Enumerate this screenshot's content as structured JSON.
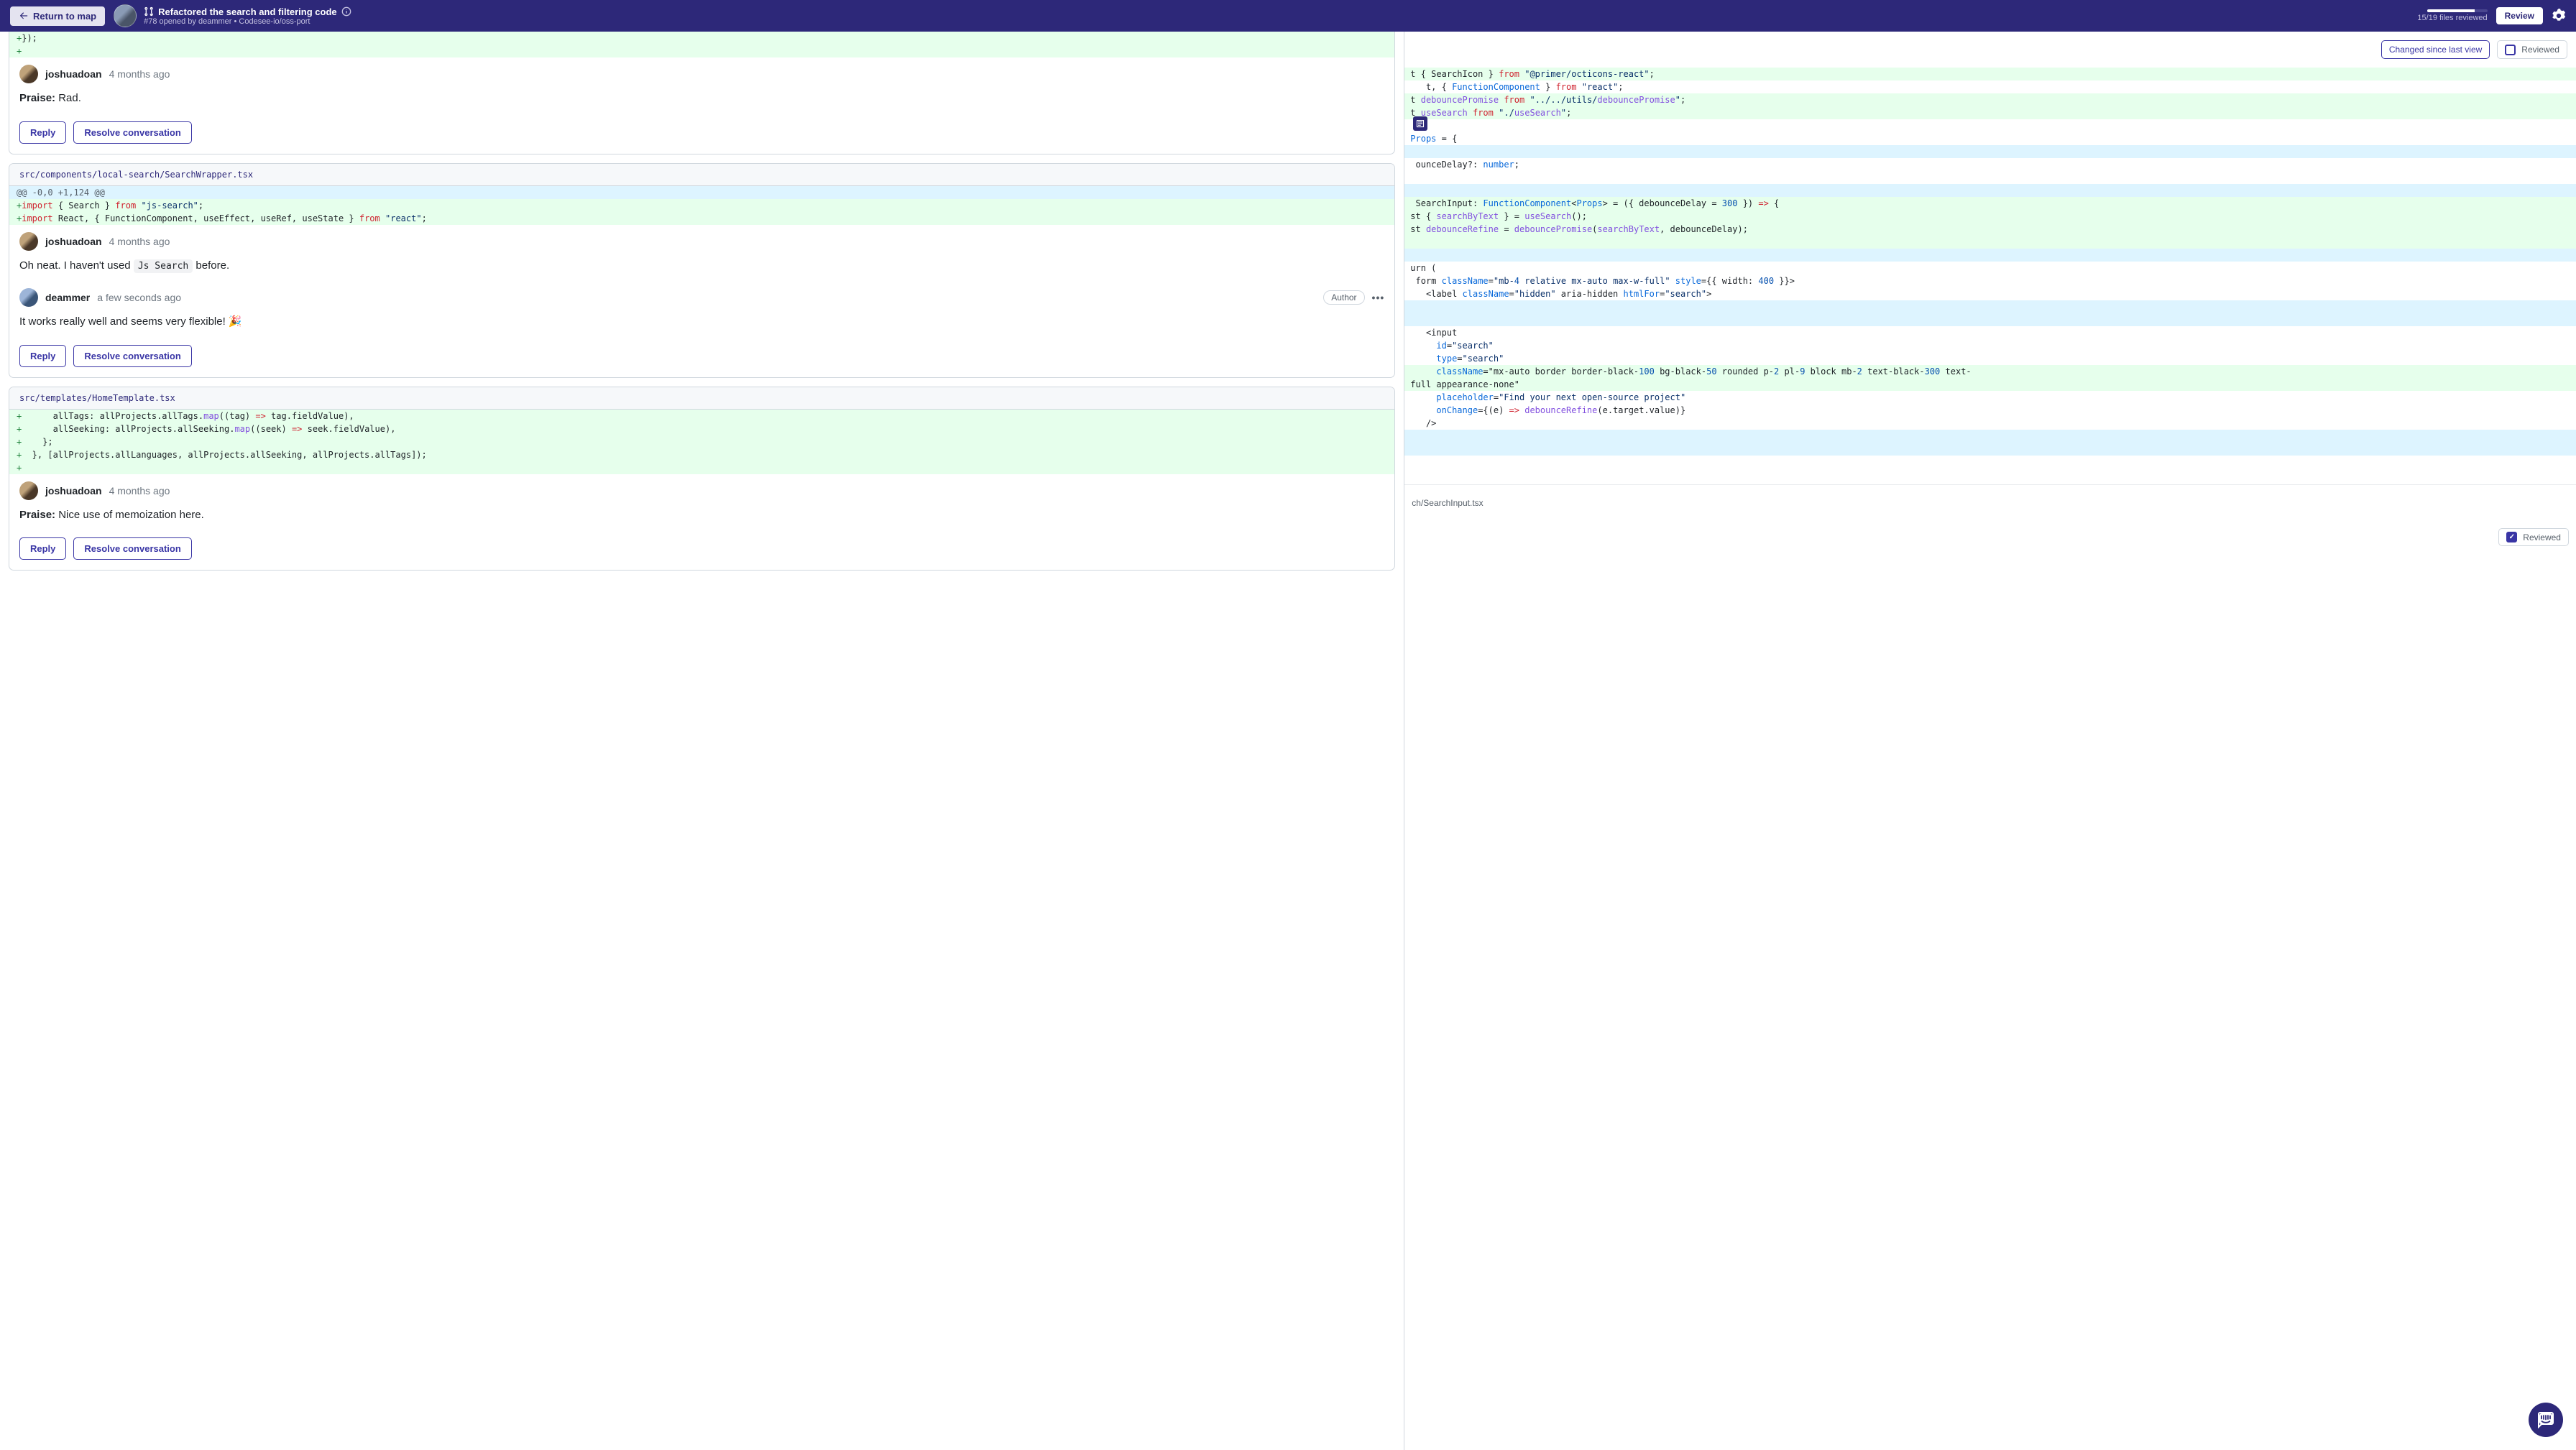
{
  "header": {
    "return_label": "Return to map",
    "pr_title": "Refactored the search and filtering code",
    "pr_meta": "#78 opened by deammer • Codesee-io/oss-port",
    "files_reviewed": "15/19 files reviewed",
    "review_btn": "Review"
  },
  "threads": [
    {
      "file": "",
      "diff_pre": "+});\n+",
      "comments": [
        {
          "author": "joshuadoan",
          "time": "4 months ago",
          "body_prefix": "Praise:",
          "body_rest": " Rad."
        }
      ],
      "reply": "Reply",
      "resolve": "Resolve conversation"
    },
    {
      "file": "src/components/local-search/SearchWrapper.tsx",
      "hunk": "@@ -0,0 +1,124 @@",
      "lines": [
        {
          "t": "add",
          "content": "+import { Search } from \"js-search\";"
        },
        {
          "t": "add",
          "content": "+import React, { FunctionComponent, useEffect, useRef, useState } from \"react\";"
        }
      ],
      "comments": [
        {
          "author": "joshuadoan",
          "time": "4 months ago",
          "body_html": "Oh neat. I haven't used <code>Js Search</code> before."
        },
        {
          "author": "deammer",
          "time": "a few seconds ago",
          "badge": "Author",
          "body_html": "It works really well and seems very flexible! 🎉"
        }
      ],
      "reply": "Reply",
      "resolve": "Resolve conversation"
    },
    {
      "file": "src/templates/HomeTemplate.tsx",
      "lines": [
        {
          "t": "add",
          "content": "+      allTags: allProjects.allTags.map((tag) => tag.fieldValue),"
        },
        {
          "t": "add",
          "content": "+      allSeeking: allProjects.allSeeking.map((seek) => seek.fieldValue),"
        },
        {
          "t": "add",
          "content": "+    };"
        },
        {
          "t": "add",
          "content": "+  }, [allProjects.allLanguages, allProjects.allSeeking, allProjects.allTags]);"
        },
        {
          "t": "add",
          "content": "+"
        }
      ],
      "comments": [
        {
          "author": "joshuadoan",
          "time": "4 months ago",
          "body_prefix": "Praise:",
          "body_rest": " Nice use of memoization here."
        }
      ],
      "reply": "Reply",
      "resolve": "Resolve conversation"
    }
  ],
  "right": {
    "changed_label": "Changed since last view",
    "reviewed_label": "Reviewed",
    "file2": "ch/SearchInput.tsx"
  },
  "code_right": [
    {
      "cls": "add",
      "txt": "t { SearchIcon } from \"@primer/octicons-react\";"
    },
    {
      "cls": "ctx",
      "txt": "   t, { FunctionComponent } from \"react\";"
    },
    {
      "cls": "add",
      "txt": "t debouncePromise from \"../../utils/debouncePromise\";"
    },
    {
      "cls": "add",
      "txt": "t useSearch from \"./useSearch\";"
    },
    {
      "cls": "ctx",
      "txt": ""
    },
    {
      "cls": "ctx",
      "txt": "Props = {"
    },
    {
      "cls": "hunk",
      "txt": ""
    },
    {
      "cls": "ctx",
      "txt": " ounceDelay?: number;"
    },
    {
      "cls": "ctx",
      "txt": ""
    },
    {
      "cls": "hunk",
      "txt": ""
    },
    {
      "cls": "add",
      "txt": " SearchInput: FunctionComponent<Props> = ({ debounceDelay = 300 }) => {"
    },
    {
      "cls": "add",
      "txt": "st { searchByText } = useSearch();"
    },
    {
      "cls": "add",
      "txt": "st debounceRefine = debouncePromise(searchByText, debounceDelay);"
    },
    {
      "cls": "add",
      "txt": ""
    },
    {
      "cls": "hunk",
      "txt": ""
    },
    {
      "cls": "ctx",
      "txt": "urn ("
    },
    {
      "cls": "ctx",
      "txt": " form className=\"mb-4 relative mx-auto max-w-full\" style={{ width: 400 }}>"
    },
    {
      "cls": "ctx",
      "txt": "   <label className=\"hidden\" aria-hidden htmlFor=\"search\">"
    },
    {
      "cls": "blue",
      "txt": ""
    },
    {
      "cls": "blue",
      "txt": ""
    },
    {
      "cls": "ctx",
      "txt": "   <input"
    },
    {
      "cls": "ctx",
      "txt": "     id=\"search\""
    },
    {
      "cls": "ctx",
      "txt": "     type=\"search\""
    },
    {
      "cls": "add",
      "txt": "     className=\"mx-auto border border-black-100 bg-black-50 rounded p-2 pl-9 block mb-2 text-black-300 text-"
    },
    {
      "cls": "add",
      "txt": "full appearance-none\""
    },
    {
      "cls": "ctx",
      "txt": "     placeholder=\"Find your next open-source project\""
    },
    {
      "cls": "ctx",
      "txt": "     onChange={(e) => debounceRefine(e.target.value)}"
    },
    {
      "cls": "ctx",
      "txt": "   />"
    },
    {
      "cls": "blue",
      "txt": ""
    },
    {
      "cls": "blue",
      "txt": ""
    }
  ]
}
